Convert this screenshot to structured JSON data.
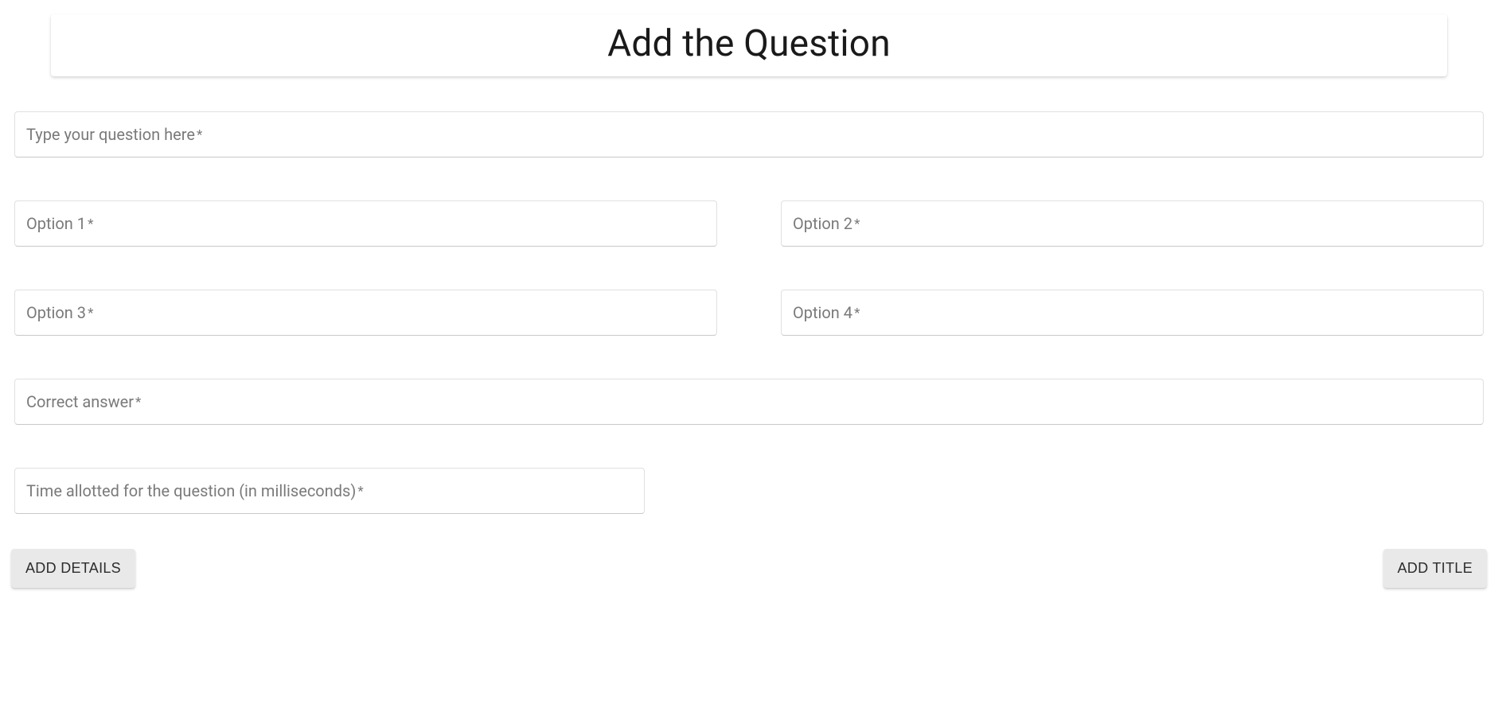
{
  "header": {
    "title": "Add the Question"
  },
  "fields": {
    "question": {
      "label": "Type your question here",
      "value": ""
    },
    "option1": {
      "label": "Option 1",
      "value": ""
    },
    "option2": {
      "label": "Option 2",
      "value": ""
    },
    "option3": {
      "label": "Option 3",
      "value": ""
    },
    "option4": {
      "label": "Option 4",
      "value": ""
    },
    "correct": {
      "label": "Correct answer",
      "value": ""
    },
    "time": {
      "label": "Time allotted for the question (in milliseconds)",
      "value": ""
    }
  },
  "buttons": {
    "add_details": "ADD DETAILS",
    "add_title": "ADD TITLE"
  },
  "required_mark": "*"
}
